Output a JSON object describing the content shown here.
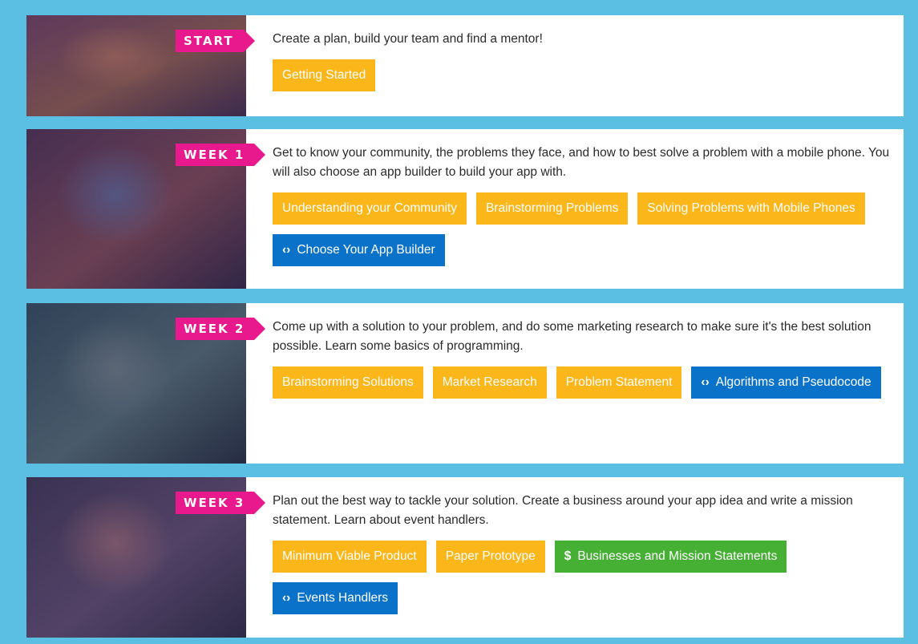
{
  "rows": [
    {
      "badge": "START",
      "description": "Create a plan, build your team and find a mentor!",
      "buttons": [
        {
          "label": "Getting Started",
          "color": "#fbb61a",
          "icon": null
        }
      ]
    },
    {
      "badge": "WEEK 1",
      "description": "Get to know your community, the problems they face, and how to best solve a problem with a mobile phone. You will also choose an app builder to build your app with.",
      "buttons": [
        {
          "label": "Understanding your Community",
          "color": "#fbb61a",
          "icon": null
        },
        {
          "label": "Brainstorming Problems",
          "color": "#fbb61a",
          "icon": null
        },
        {
          "label": "Solving Problems with Mobile Phones",
          "color": "#fbb61a",
          "icon": null
        },
        {
          "label": "Choose Your App Builder",
          "color": "#0a72c9",
          "icon": "code-icon",
          "icon_glyph": "‹›"
        }
      ]
    },
    {
      "badge": "WEEK 2",
      "description": "Come up with a solution to your problem, and do some marketing research to make sure it's the best solution possible. Learn some basics of programming.",
      "buttons": [
        {
          "label": "Brainstorming Solutions",
          "color": "#fbb61a",
          "icon": null
        },
        {
          "label": "Market Research",
          "color": "#fbb61a",
          "icon": null
        },
        {
          "label": "Problem Statement",
          "color": "#fbb61a",
          "icon": null
        },
        {
          "label": "Algorithms and Pseudocode",
          "color": "#0a72c9",
          "icon": "code-icon",
          "icon_glyph": "‹›"
        }
      ]
    },
    {
      "badge": "WEEK 3",
      "description": "Plan out the best way to tackle your solution. Create a business around your app idea and write a mission statement. Learn about event handlers.",
      "buttons": [
        {
          "label": "Minimum Viable Product",
          "color": "#fbb61a",
          "icon": null
        },
        {
          "label": "Paper Prototype",
          "color": "#fbb61a",
          "icon": null
        },
        {
          "label": "Businesses and Mission Statements",
          "color": "#46b035",
          "icon": "dollar-icon",
          "icon_glyph": "$"
        },
        {
          "label": "Events Handlers",
          "color": "#0a72c9",
          "icon": "code-icon",
          "icon_glyph": "‹›"
        }
      ]
    }
  ],
  "theme": {
    "page_background": "#5bbfe3",
    "badge_color": "#e8198c",
    "yellow": "#fbb61a",
    "blue": "#0a72c9",
    "green": "#46b035"
  }
}
